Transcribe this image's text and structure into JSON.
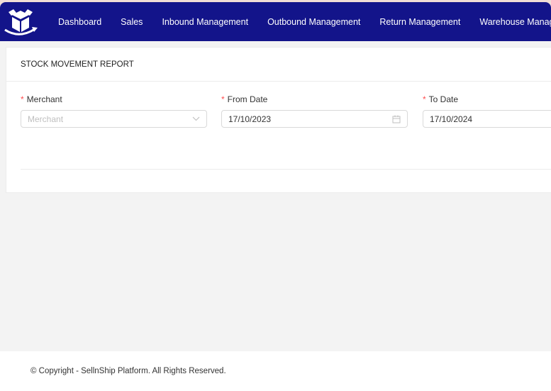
{
  "nav": {
    "logo": "box-logo",
    "items": [
      "Dashboard",
      "Sales",
      "Inbound Management",
      "Outbound Management",
      "Return Management",
      "Warehouse Management"
    ]
  },
  "report": {
    "title": "STOCK MOVEMENT REPORT",
    "merchant": {
      "label": "Merchant",
      "placeholder": "Merchant",
      "value": ""
    },
    "from_date": {
      "label": "From Date",
      "value": "17/10/2023"
    },
    "to_date": {
      "label": "To Date",
      "value": "17/10/2024"
    },
    "required_mark": "*"
  },
  "footer": {
    "text": "© Copyright - SellnShip Platform. All Rights Reserved."
  },
  "colors": {
    "nav_bg": "#13148a",
    "required": "#ff4d4f"
  }
}
